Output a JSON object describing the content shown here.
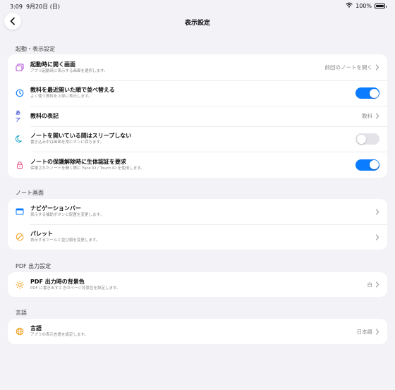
{
  "status_bar": {
    "time": "3:09",
    "date": "9月20日 (日)",
    "battery": "100%"
  },
  "nav": {
    "title": "表示設定"
  },
  "sections": [
    {
      "header": "起動・表示設定",
      "rows": [
        {
          "title": "起動時に開く画面",
          "subtitle": "アプリ起動時に表示する画面を選択します。",
          "value": "前回のノートを開く",
          "icon": "window-stack-icon"
        },
        {
          "title": "教科を最近開いた順で並べ替える",
          "subtitle": "よく使う教科を上部に表示します。",
          "toggle": "on",
          "icon": "clock-icon"
        },
        {
          "title": "教科の表記",
          "icon_text": "あア",
          "value": "教科",
          "icon": "kana-icon"
        },
        {
          "title": "ノートを開いている間はスリープしない",
          "subtitle": "書き込み中は画面を常にオンに保ちます。",
          "toggle": "off",
          "icon": "moon-icon"
        },
        {
          "title": "ノートの保護解除時に生体認証を要求",
          "subtitle": "保護されたノートを開く際に Face ID / Touch ID を使用します。",
          "toggle": "on",
          "icon": "lock-icon"
        }
      ]
    },
    {
      "header": "ノート画面",
      "rows": [
        {
          "title": "ナビゲーションバー",
          "subtitle": "表示する補助ボタンと配置を変更します。",
          "icon": "navigation-bar-icon"
        },
        {
          "title": "パレット",
          "subtitle": "表示するツールと並び順を変更します。",
          "icon": "palette-icon"
        }
      ]
    },
    {
      "header": "PDF 出力設定",
      "rows": [
        {
          "title": "PDF 出力時の背景色",
          "subtitle": "PDF に書き出すときのページ背景色を設定します。",
          "value": "白",
          "icon": "sun-icon"
        }
      ]
    },
    {
      "header": "言語",
      "rows": [
        {
          "title": "言語",
          "subtitle": "アプリの表示言語を設定します。",
          "value": "日本語",
          "icon": "globe-icon"
        }
      ]
    }
  ],
  "colors": {
    "accent_blue": "#0a7cff",
    "purple": "#b24bd6",
    "orange": "#f0a020",
    "pink": "#e0457b",
    "teal": "#19a5c9",
    "background": "#f2f2f7"
  }
}
